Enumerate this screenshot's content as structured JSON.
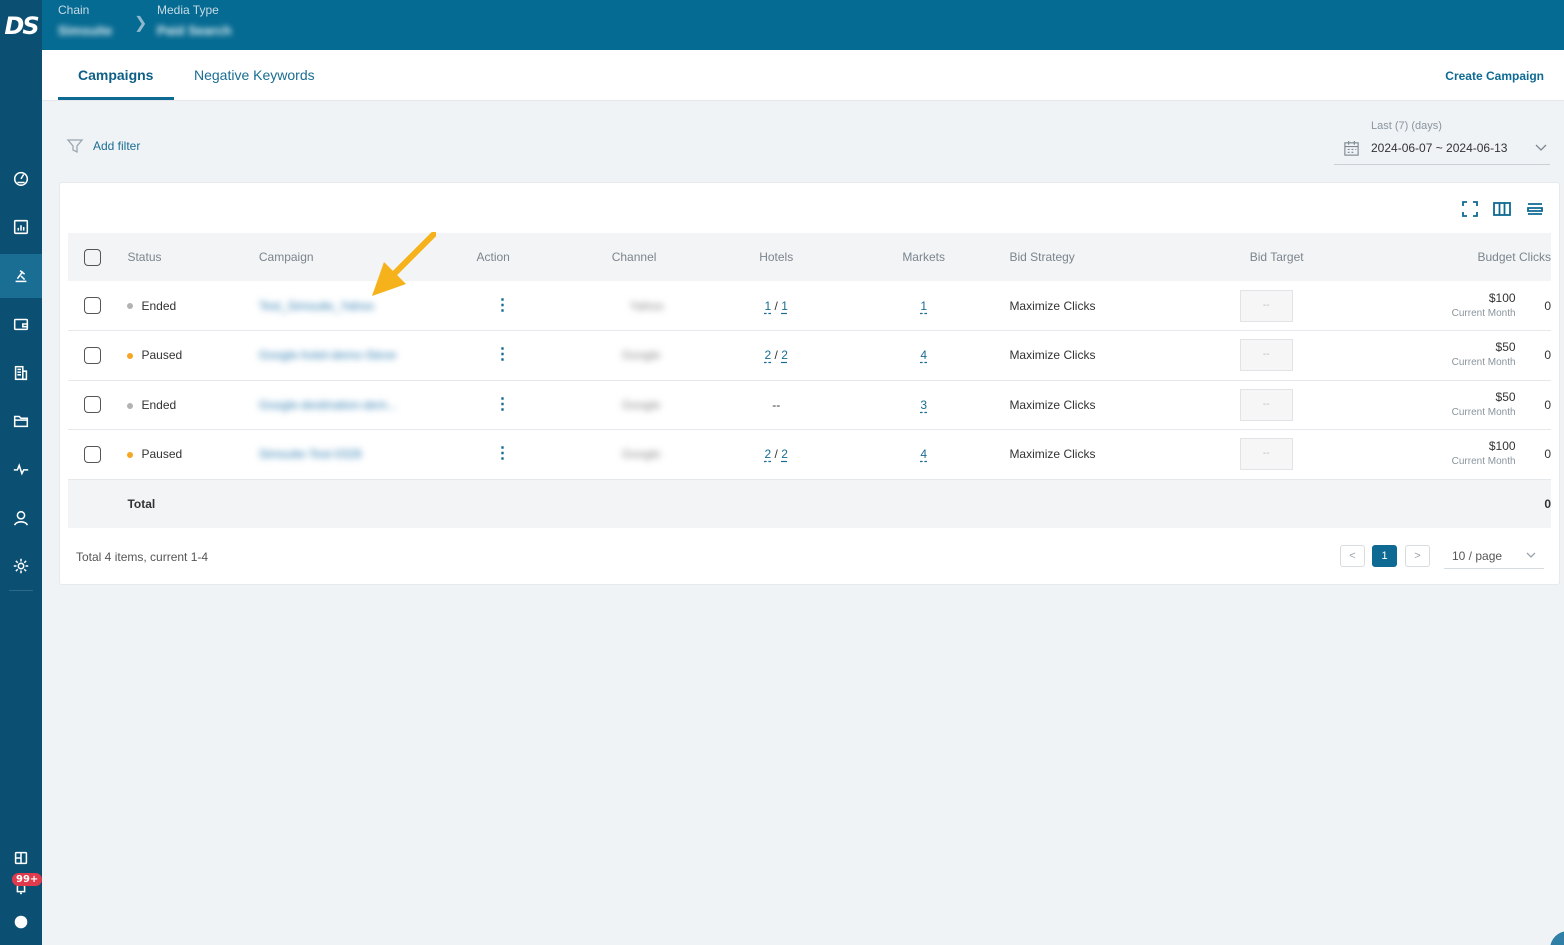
{
  "logo": "DS",
  "breadcrumb": {
    "chain_label": "Chain",
    "chain_value": "Simsuite",
    "media_label": "Media Type",
    "media_value": "Paid Search"
  },
  "tabs": [
    {
      "label": "Campaigns",
      "active": true
    },
    {
      "label": "Negative Keywords",
      "active": false
    }
  ],
  "create_campaign": "Create Campaign",
  "filter": {
    "add_label": "Add filter"
  },
  "date_range": {
    "label": "Last (7) (days)",
    "value": "2024-06-07 ~ 2024-06-13"
  },
  "table": {
    "headers": [
      "Status",
      "Campaign",
      "Action",
      "Channel",
      "Hotels",
      "Markets",
      "Bid Strategy",
      "Bid Target",
      "Budget",
      "Clicks"
    ],
    "rows": [
      {
        "status": "Ended",
        "campaign": "Test_Simsuite_Yahoo",
        "channel": "Yahoo",
        "hotels": [
          "1",
          "1"
        ],
        "markets": "1",
        "bid_strategy": "Maximize Clicks",
        "bid_target": "--",
        "budget": "$100",
        "budget_period": "Current Month",
        "clicks": "0"
      },
      {
        "status": "Paused",
        "campaign": "Google-hotel-demo-Steve",
        "channel": "Google",
        "hotels": [
          "2",
          "2"
        ],
        "markets": "4",
        "bid_strategy": "Maximize Clicks",
        "bid_target": "--",
        "budget": "$50",
        "budget_period": "Current Month",
        "clicks": "0"
      },
      {
        "status": "Ended",
        "campaign": "Google-destination-dem...",
        "channel": "Google",
        "hotels_text": "--",
        "markets": "3",
        "bid_strategy": "Maximize Clicks",
        "bid_target": "--",
        "budget": "$50",
        "budget_period": "Current Month",
        "clicks": "0"
      },
      {
        "status": "Paused",
        "campaign": "Simsuite-Test-0328",
        "channel": "Google",
        "hotels": [
          "2",
          "2"
        ],
        "markets": "4",
        "bid_strategy": "Maximize Clicks",
        "bid_target": "--",
        "budget": "$100",
        "budget_period": "Current Month",
        "clicks": "0"
      }
    ],
    "total_label": "Total",
    "total_clicks": "0"
  },
  "pagination": {
    "summary": "Total 4 items, current 1-4",
    "current_page": "1",
    "prev": "<",
    "next": ">",
    "page_size": "10 / page"
  },
  "notification_badge": "99+",
  "sidebar_icons": [
    "dashboard-icon",
    "report-icon",
    "campaign-icon",
    "wallet-icon",
    "building-icon",
    "folder-icon",
    "activity-icon",
    "user-icon",
    "settings-icon",
    "grid-icon",
    "bell-icon",
    "help-icon"
  ],
  "colors": {
    "sidebar": "#0b4f72",
    "topbar": "#066b92",
    "accent": "#0e6a92",
    "paused": "#f5a623",
    "ended": "#b3b3b3",
    "badge": "#e03a4c",
    "arrow": "#f5b21b"
  }
}
